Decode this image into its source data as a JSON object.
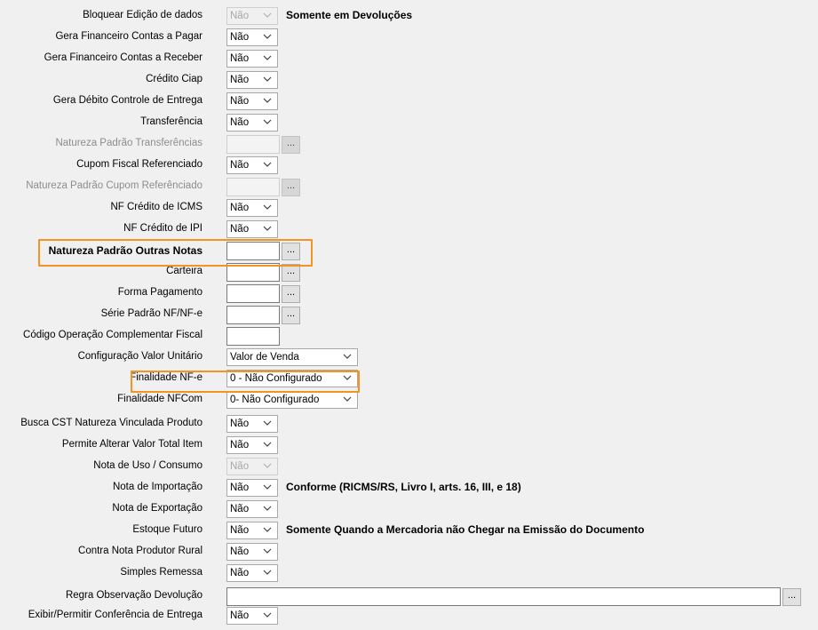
{
  "fields": [
    {
      "label": "Bloquear Edição de dados",
      "type": "select",
      "value": "Não",
      "disabled": true,
      "note": "Somente em Devoluções"
    },
    {
      "label": "Gera Financeiro Contas a Pagar",
      "type": "select",
      "value": "Não"
    },
    {
      "label": "Gera Financeiro Contas a Receber",
      "type": "select",
      "value": "Não"
    },
    {
      "label": "Crédito Ciap",
      "type": "select",
      "value": "Não"
    },
    {
      "label": "Gera Débito Controle de Entrega",
      "type": "select",
      "value": "Não"
    },
    {
      "label": "Transferência",
      "type": "select",
      "value": "Não"
    },
    {
      "label": "Natureza Padrão Transferências",
      "type": "lookup",
      "disabled": true,
      "value": "",
      "button": "..."
    },
    {
      "label": "Cupom Fiscal Referenciado",
      "type": "select",
      "value": "Não"
    },
    {
      "label": "Natureza Padrão Cupom Referênciado",
      "type": "lookup",
      "disabled": true,
      "value": "",
      "button": "..."
    },
    {
      "label": "NF Crédito de ICMS",
      "type": "select",
      "value": "Não"
    },
    {
      "label": "NF Crédito de IPI",
      "type": "select",
      "value": "Não"
    },
    {
      "label": "Natureza Padrão Outras Notas",
      "type": "lookup",
      "bold": true,
      "value": "",
      "button": "..."
    },
    {
      "label": "Carteira",
      "type": "lookup",
      "value": "",
      "button": "..."
    },
    {
      "label": "Forma Pagamento",
      "type": "lookup",
      "value": "",
      "button": "..."
    },
    {
      "label": "Série Padrão NF/NF-e",
      "type": "lookup",
      "value": "",
      "button": "..."
    },
    {
      "label": "Código Operação Complementar Fiscal",
      "type": "text",
      "value": ""
    },
    {
      "label": "Configuração Valor Unitário",
      "type": "select",
      "wide": true,
      "value": "Valor de Venda"
    },
    {
      "label": "Finalidade NF-e",
      "type": "select",
      "wide": true,
      "value": "0 - Não Configurado"
    },
    {
      "label": "Finalidade NFCom",
      "type": "select",
      "wide": true,
      "value": "0- Não Configurado"
    },
    {
      "label": "Busca CST Natureza Vinculada Produto",
      "type": "select",
      "value": "Não"
    },
    {
      "label": "Permite Alterar Valor Total Item",
      "type": "select",
      "value": "Não"
    },
    {
      "label": "Nota de Uso / Consumo",
      "type": "select",
      "value": "Não",
      "disabled": true
    },
    {
      "label": "Nota de Importação",
      "type": "select",
      "value": "Não",
      "note": "Conforme (RICMS/RS, Livro I, arts. 16, III, e 18)"
    },
    {
      "label": "Nota de Exportação",
      "type": "select",
      "value": "Não"
    },
    {
      "label": "Estoque Futuro",
      "type": "select",
      "value": "Não",
      "note": "Somente Quando a Mercadoria não Chegar na Emissão do Documento"
    },
    {
      "label": "Contra Nota Produtor Rural",
      "type": "select",
      "value": "Não"
    },
    {
      "label": "Simples Remessa",
      "type": "select",
      "value": "Não"
    },
    {
      "label": "Regra Observação Devolução",
      "type": "longlookup",
      "value": "",
      "button": "..."
    },
    {
      "label": "Exibir/Permitir Conferência de Entrega",
      "type": "select",
      "value": "Não"
    }
  ],
  "highlight_color": "#f39322"
}
